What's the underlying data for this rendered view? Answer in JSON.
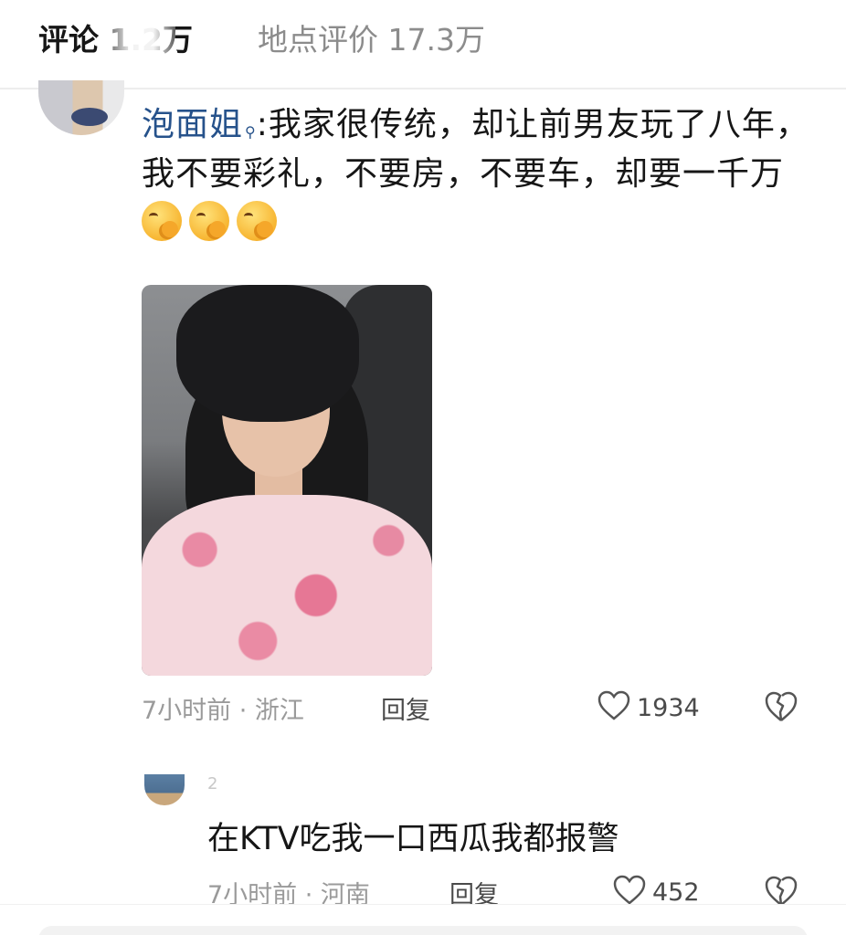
{
  "tabs": {
    "comments_label": "评论 1.2万",
    "place_reviews_label": "地点评价 17.3万"
  },
  "comment": {
    "username": "泡面姐",
    "text": ":我家很传统，却让前男友玩了八年，我不要彩礼，不要房，不要车，却要一千万",
    "emoji_count": 3,
    "emoji_icon": "face-with-hand-over-mouth",
    "time": "7小时前 · 浙江",
    "reply_label": "回复",
    "like_count": "1934"
  },
  "reply": {
    "username_hint": "2",
    "text": "在KTV吃我一口西瓜我都报警",
    "time": "7小时前 · 河南",
    "reply_label": "回复",
    "like_count": "452"
  },
  "colors": {
    "username": "#26528b",
    "meta_gray": "#9a9a9a",
    "inactive_tab": "#8c8c8c"
  }
}
